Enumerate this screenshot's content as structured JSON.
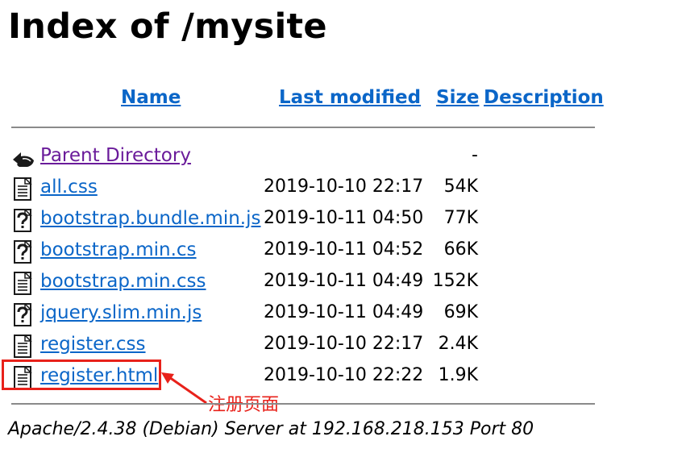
{
  "page": {
    "title": "Index of /mysite"
  },
  "columns": {
    "name": "Name",
    "last_modified": "Last modified",
    "size": "Size",
    "description": "Description"
  },
  "parent": {
    "label": "Parent Directory",
    "size": "-",
    "icon": "back-arrow-icon"
  },
  "files": [
    {
      "name": "all.css",
      "date": "2019-10-10 22:17",
      "size": "54K",
      "icon": "text-file-icon"
    },
    {
      "name": "bootstrap.bundle.min.js",
      "date": "2019-10-11 04:50",
      "size": "77K",
      "icon": "unknown-file-icon"
    },
    {
      "name": "bootstrap.min.cs",
      "date": "2019-10-11 04:52",
      "size": "66K",
      "icon": "unknown-file-icon"
    },
    {
      "name": "bootstrap.min.css",
      "date": "2019-10-11 04:49",
      "size": "152K",
      "icon": "text-file-icon"
    },
    {
      "name": "jquery.slim.min.js",
      "date": "2019-10-11 04:49",
      "size": "69K",
      "icon": "unknown-file-icon"
    },
    {
      "name": "register.css",
      "date": "2019-10-10 22:17",
      "size": "2.4K",
      "icon": "text-file-icon"
    },
    {
      "name": "register.html",
      "date": "2019-10-10 22:22",
      "size": "1.9K",
      "icon": "text-file-icon"
    }
  ],
  "annotation": {
    "text": "注册页面",
    "color": "#e8211a"
  },
  "footer": {
    "text": "Apache/2.4.38 (Debian) Server at 192.168.218.153 Port 80"
  },
  "colors": {
    "link": "#0b66c8",
    "visited": "#6a1b9a",
    "rule": "#8a8a8a"
  }
}
